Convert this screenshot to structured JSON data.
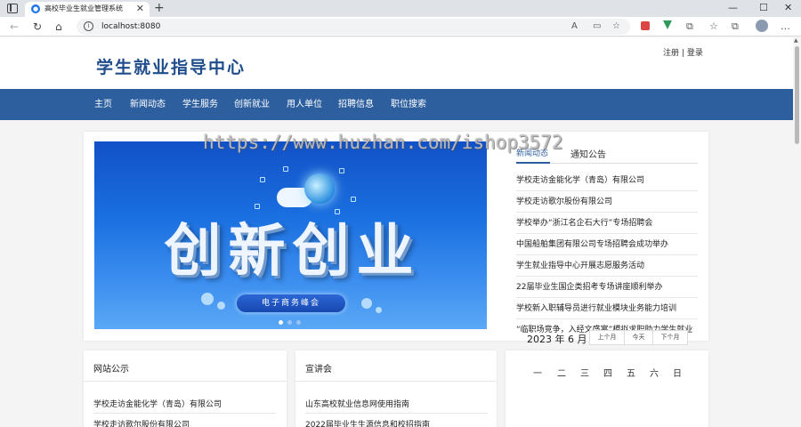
{
  "browser": {
    "tab_title": "高校毕业生就业管理系统",
    "tab_close": "✕",
    "new_tab": "+",
    "minimize": "—",
    "maximize": "☐",
    "close": "✕",
    "url": "localhost:8080",
    "icons": {
      "back": "←",
      "forward": "→",
      "reload": "↻",
      "home": "⌂",
      "read_aloud": "A",
      "split": "▭",
      "favorite": "☆",
      "extensions": "⚙",
      "collections": "☆",
      "tab_sync": "⧉",
      "more": "…",
      "favorite_add": "☆",
      "puzzle": "⧉",
      "copilot": "✦"
    }
  },
  "header": {
    "site_title": "学生就业指导中心",
    "register": "注册",
    "separator": "|",
    "login": "登录"
  },
  "nav": {
    "items": [
      "主页",
      "新闻动态",
      "学生服务",
      "创新就业",
      "用人单位",
      "招聘信息",
      "职位搜索"
    ]
  },
  "banner": {
    "big_text": "创新创业",
    "sub_text": "电子商务峰会"
  },
  "watermark": "https://www.huzhan.com/ishop3572",
  "news": {
    "tab_active": "新闻动态",
    "tab_other": "通知公告",
    "items": [
      "学校走访金能化学（青岛）有限公司",
      "学校走访歌尔股份有限公司",
      "学校举办“浙江名企石大行”专场招聘会",
      "中国船舶集团有限公司专场招聘会成功举办",
      "学生就业指导中心开展志愿服务活动",
      "22届毕业生国企类招考专场讲座顺利举办",
      "学校新入职辅导员进行就业模块业务能力培训",
      "“临职场竞争，入经文盛宴”模拟求职助力学生就业"
    ]
  },
  "notice": {
    "title": "网站公示",
    "items": [
      "学校走访金能化学（青岛）有限公司",
      "学校走访歌尔股份有限公司"
    ]
  },
  "fair": {
    "title": "宣讲会",
    "items": [
      "山东高校就业信息网使用指南",
      "2022届毕业生生源信息和校招指南"
    ]
  },
  "calendar": {
    "year": "2023",
    "year_unit": "年",
    "month": "6",
    "month_unit": "月",
    "prev": "上个月",
    "today": "今天",
    "next": "下个月",
    "weekdays": [
      "一",
      "二",
      "三",
      "四",
      "五",
      "六",
      "日"
    ]
  }
}
